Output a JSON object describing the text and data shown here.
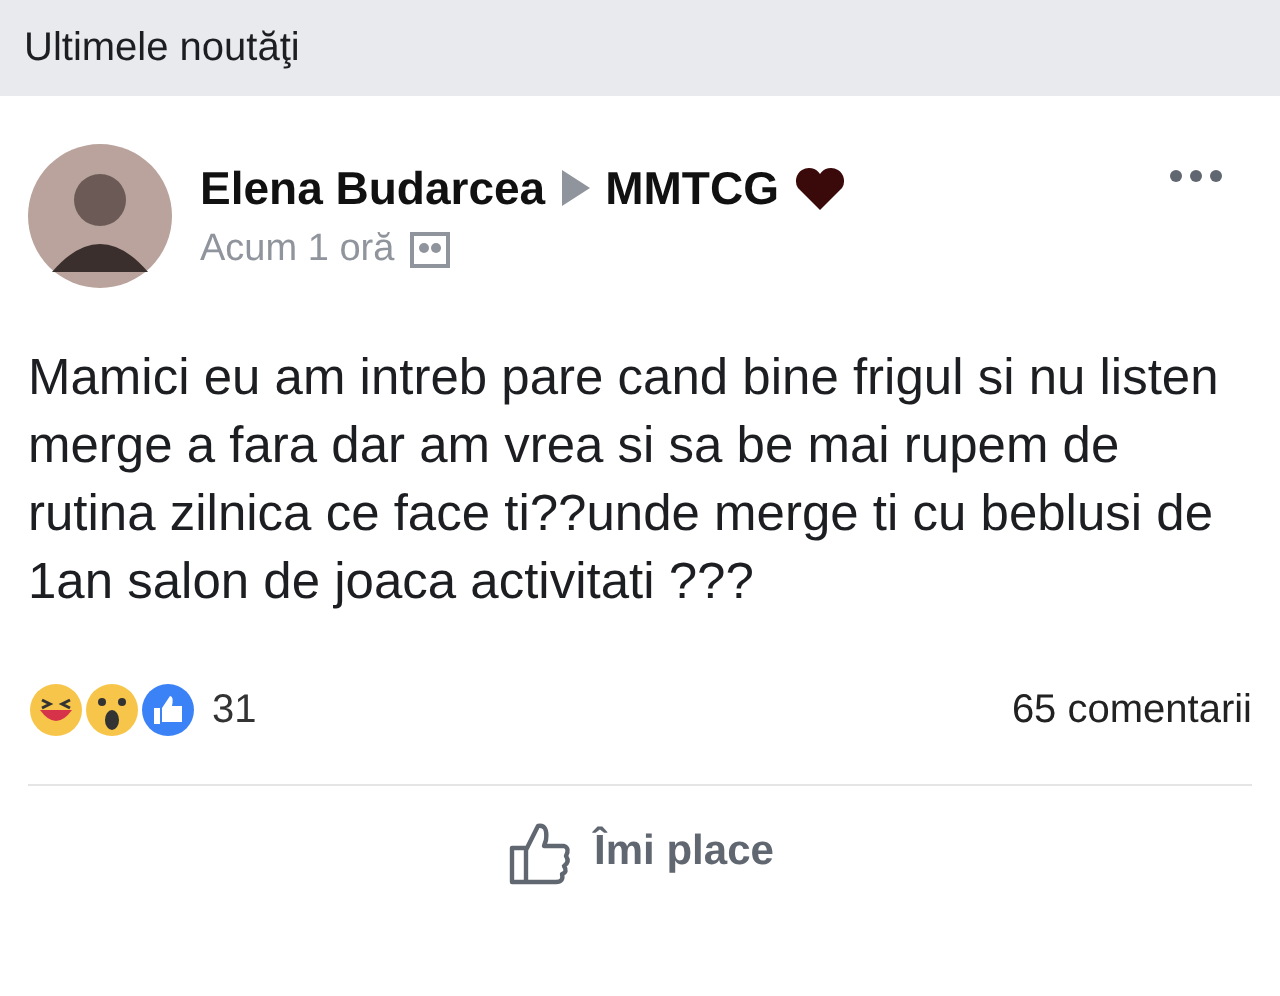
{
  "header": {
    "title": "Ultimele noutăţi"
  },
  "post": {
    "author": "Elena Budarcea",
    "group": "MMTCG",
    "time": "Acum 1 oră",
    "text": "Mamici eu am intreb pare cand bine frigul si nu listen merge a fara dar am vrea si sa be mai rupem de rutina zilnica ce face ti??unde merge ti cu beblusi de 1an salon de joaca activitati ???",
    "reaction_count": "31",
    "comments": "65 comentarii",
    "like_label": "Îmi place"
  }
}
